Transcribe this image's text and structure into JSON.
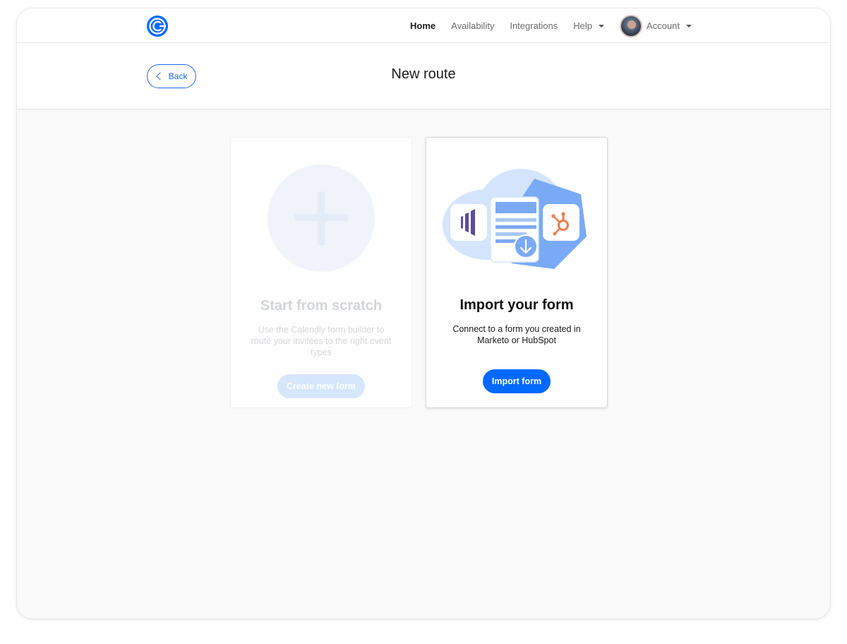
{
  "nav": {
    "items": [
      {
        "label": "Home",
        "active": true
      },
      {
        "label": "Availability"
      },
      {
        "label": "Integrations"
      },
      {
        "label": "Help"
      },
      {
        "label": "Account"
      }
    ]
  },
  "header": {
    "back_label": "Back",
    "title": "New route"
  },
  "cards": {
    "scratch": {
      "title": "Start from scratch",
      "description": "Use the Calendly form builder to route your invitees to the right event types",
      "button": "Create new form"
    },
    "import": {
      "title": "Import your form",
      "description": "Connect to a form you created in Marketo or HubSpot",
      "button": "Import form"
    }
  },
  "colors": {
    "brand": "#0069ff",
    "hubspot": "#f07a4e",
    "marketo": "#5c4c9f"
  }
}
